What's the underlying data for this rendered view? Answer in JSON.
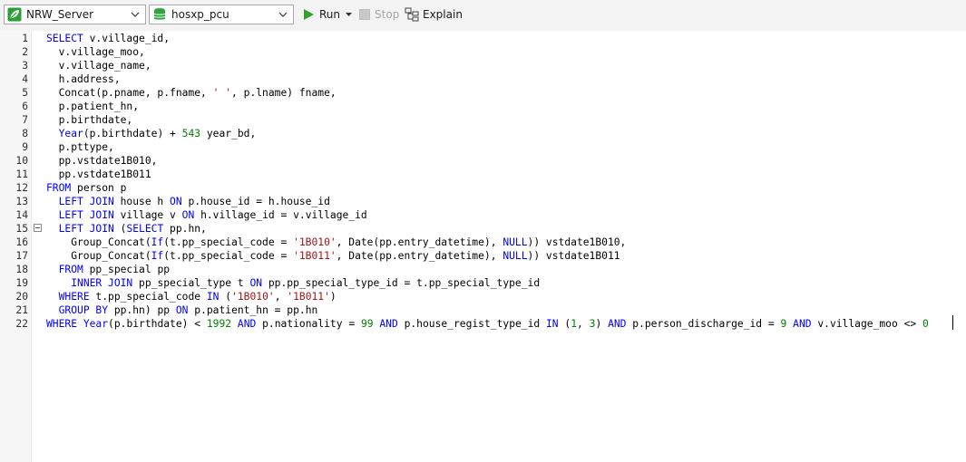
{
  "toolbar": {
    "connection": "NRW_Server",
    "database": "hosxp_pcu",
    "run_label": "Run",
    "stop_label": "Stop",
    "explain_label": "Explain"
  },
  "colors": {
    "keyword": "#0000ff",
    "number": "#008000",
    "string": "#a31515"
  },
  "editor": {
    "lines": [
      [
        [
          "kw",
          "SELECT"
        ],
        [
          "t",
          " v.village_id,"
        ]
      ],
      [
        [
          "t",
          "  v.village_moo,"
        ]
      ],
      [
        [
          "t",
          "  v.village_name,"
        ]
      ],
      [
        [
          "t",
          "  h.address,"
        ]
      ],
      [
        [
          "t",
          "  Concat(p.pname, p.fname, "
        ],
        [
          "str",
          "' '"
        ],
        [
          "t",
          ", p.lname) fname,"
        ]
      ],
      [
        [
          "t",
          "  p.patient_hn,"
        ]
      ],
      [
        [
          "t",
          "  p.birthdate,"
        ]
      ],
      [
        [
          "t",
          "  "
        ],
        [
          "fn",
          "Year"
        ],
        [
          "t",
          "(p.birthdate) + "
        ],
        [
          "num",
          "543"
        ],
        [
          "t",
          " year_bd,"
        ]
      ],
      [
        [
          "t",
          "  p.pttype,"
        ]
      ],
      [
        [
          "t",
          "  pp.vstdate1B010,"
        ]
      ],
      [
        [
          "t",
          "  pp.vstdate1B011"
        ]
      ],
      [
        [
          "kw",
          "FROM"
        ],
        [
          "t",
          " person p"
        ]
      ],
      [
        [
          "t",
          "  "
        ],
        [
          "kw",
          "LEFT JOIN"
        ],
        [
          "t",
          " house h "
        ],
        [
          "kw",
          "ON"
        ],
        [
          "t",
          " p.house_id = h.house_id"
        ]
      ],
      [
        [
          "t",
          "  "
        ],
        [
          "kw",
          "LEFT JOIN"
        ],
        [
          "t",
          " village v "
        ],
        [
          "kw",
          "ON"
        ],
        [
          "t",
          " h.village_id = v.village_id"
        ]
      ],
      [
        [
          "t",
          "  "
        ],
        [
          "kw",
          "LEFT JOIN"
        ],
        [
          "t",
          " ("
        ],
        [
          "kw",
          "SELECT"
        ],
        [
          "t",
          " pp.hn,"
        ]
      ],
      [
        [
          "t",
          "    Group_Concat("
        ],
        [
          "fn",
          "If"
        ],
        [
          "t",
          "(t.pp_special_code = "
        ],
        [
          "str",
          "'1B010'"
        ],
        [
          "t",
          ", Date(pp.entry_datetime), "
        ],
        [
          "kw",
          "NULL"
        ],
        [
          "t",
          ")) vstdate1B010,"
        ]
      ],
      [
        [
          "t",
          "    Group_Concat("
        ],
        [
          "fn",
          "If"
        ],
        [
          "t",
          "(t.pp_special_code = "
        ],
        [
          "str",
          "'1B011'"
        ],
        [
          "t",
          ", Date(pp.entry_datetime), "
        ],
        [
          "kw",
          "NULL"
        ],
        [
          "t",
          ")) vstdate1B011"
        ]
      ],
      [
        [
          "t",
          "  "
        ],
        [
          "kw",
          "FROM"
        ],
        [
          "t",
          " pp_special pp"
        ]
      ],
      [
        [
          "t",
          "    "
        ],
        [
          "kw",
          "INNER JOIN"
        ],
        [
          "t",
          " pp_special_type t "
        ],
        [
          "kw",
          "ON"
        ],
        [
          "t",
          " pp.pp_special_type_id = t.pp_special_type_id"
        ]
      ],
      [
        [
          "t",
          "  "
        ],
        [
          "kw",
          "WHERE"
        ],
        [
          "t",
          " t.pp_special_code "
        ],
        [
          "kw",
          "IN"
        ],
        [
          "t",
          " ("
        ],
        [
          "str",
          "'1B010'"
        ],
        [
          "t",
          ", "
        ],
        [
          "str",
          "'1B011'"
        ],
        [
          "t",
          ")"
        ]
      ],
      [
        [
          "t",
          "  "
        ],
        [
          "kw",
          "GROUP BY"
        ],
        [
          "t",
          " pp.hn) pp "
        ],
        [
          "kw",
          "ON"
        ],
        [
          "t",
          " p.patient_hn = pp.hn"
        ]
      ],
      [
        [
          "kw",
          "WHERE"
        ],
        [
          "t",
          " "
        ],
        [
          "fn",
          "Year"
        ],
        [
          "t",
          "(p.birthdate) < "
        ],
        [
          "num",
          "1992"
        ],
        [
          "t",
          " "
        ],
        [
          "kw",
          "AND"
        ],
        [
          "t",
          " p.nationality = "
        ],
        [
          "num",
          "99"
        ],
        [
          "t",
          " "
        ],
        [
          "kw",
          "AND"
        ],
        [
          "t",
          " p.house_regist_type_id "
        ],
        [
          "kw",
          "IN"
        ],
        [
          "t",
          " ("
        ],
        [
          "num",
          "1"
        ],
        [
          "t",
          ", "
        ],
        [
          "num",
          "3"
        ],
        [
          "t",
          ") "
        ],
        [
          "kw",
          "AND"
        ],
        [
          "t",
          " p.person_discharge_id = "
        ],
        [
          "num",
          "9"
        ],
        [
          "t",
          " "
        ],
        [
          "kw",
          "AND"
        ],
        [
          "t",
          " v.village_moo <> "
        ],
        [
          "num",
          "0"
        ]
      ]
    ]
  }
}
